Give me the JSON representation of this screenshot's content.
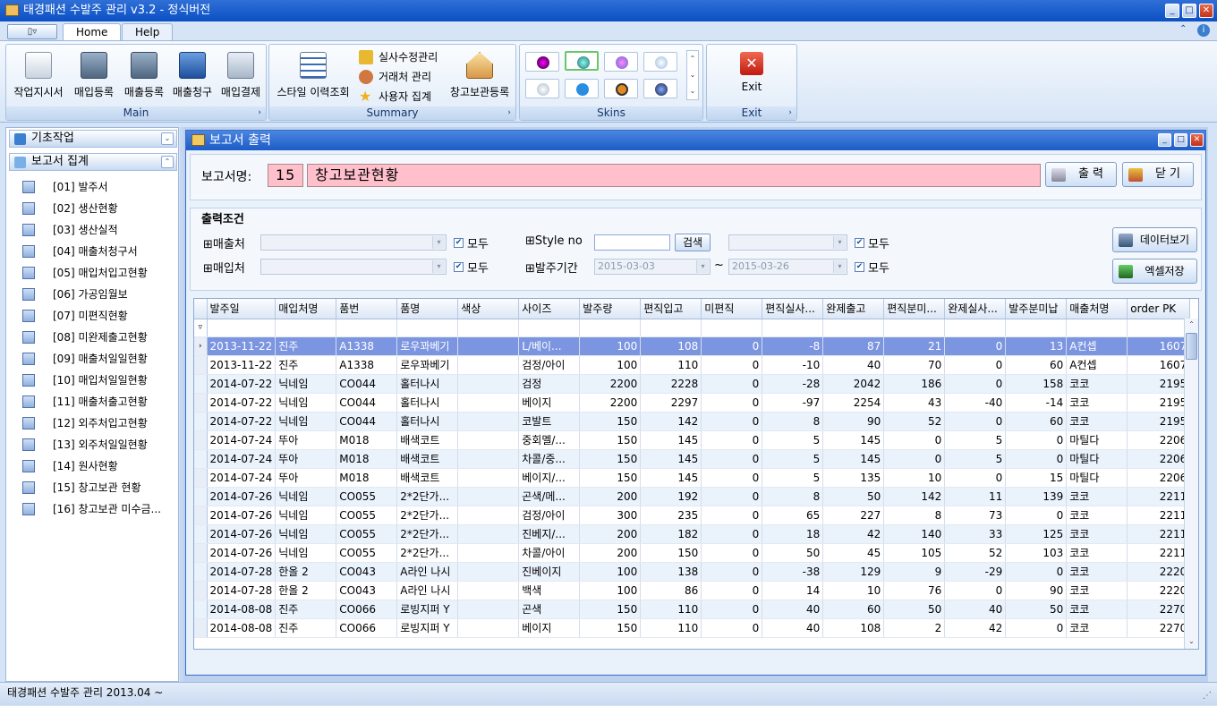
{
  "app": {
    "title": "태경패션 수발주 관리 v3.2 - 정식버전"
  },
  "ribbon": {
    "tabs": [
      "Home",
      "Help"
    ],
    "groups": {
      "main": {
        "caption": "Main",
        "buttons": [
          "작업지시서",
          "매입등록",
          "매출등록",
          "매출청구",
          "매입결제"
        ]
      },
      "summary": {
        "caption": "Summary",
        "big_button": "스타일 이력조회",
        "small_buttons": [
          "실사수정관리",
          "거래처 관리",
          "사용자 집계"
        ],
        "big_button2": "창고보관등록"
      },
      "skins": {
        "caption": "Skins"
      },
      "exit": {
        "caption": "Exit",
        "button": "Exit"
      }
    }
  },
  "nav": {
    "sections": [
      "기초작업",
      "보고서 집계"
    ],
    "items": [
      "[01] 발주서",
      "[02] 생산현황",
      "[03] 생산실적",
      "[04] 매출처청구서",
      "[05] 매입처입고현황",
      "[06] 가공임월보",
      "[07] 미편직현황",
      "[08] 미완제출고현황",
      "[09] 매출처일일현황",
      "[10] 매입처일일현황",
      "[11] 매출처출고현황",
      "[12] 외주처입고현황",
      "[13] 외주처일일현황",
      "[14] 원사현황",
      "[15] 창고보관 현황",
      "[16] 창고보관 미수금..."
    ]
  },
  "report": {
    "window_title": "보고서 출력",
    "name_label": "보고서명:",
    "number": "15",
    "name": "창고보관현황",
    "print_button": "출 력",
    "close_button": "닫 기",
    "conditions_title": "출력조건",
    "filters": {
      "sales_label": "⊞매출처",
      "purchase_label": "⊞매입처",
      "all_label": "모두",
      "style_label": "⊞Style no",
      "search_button": "검색",
      "period_label": "⊞발주기간",
      "date_from": "2015-03-03",
      "date_to": "2015-03-26",
      "tilde": "~"
    },
    "view_data_button": "데이터보기",
    "excel_button": "엑셀저장"
  },
  "grid": {
    "columns": [
      "발주일",
      "매입처명",
      "품번",
      "품명",
      "색상",
      "사이즈",
      "발주량",
      "편직입고",
      "미편직",
      "편직실사...",
      "완제출고",
      "편직분미...",
      "완제실사...",
      "발주분미납",
      "매출처명",
      "order PK"
    ],
    "rows": [
      [
        "2013-11-22",
        "진주",
        "A1338",
        "로우꽈베기",
        "",
        "L/베이...",
        "100",
        "108",
        "0",
        "-8",
        "87",
        "21",
        "0",
        "13",
        "A컨셉",
        "1607"
      ],
      [
        "2013-11-22",
        "진주",
        "A1338",
        "로우꽈베기",
        "",
        "검정/아이",
        "100",
        "110",
        "0",
        "-10",
        "40",
        "70",
        "0",
        "60",
        "A컨셉",
        "1607"
      ],
      [
        "2014-07-22",
        "닉네임",
        "CO044",
        "홀터나시",
        "",
        "검정",
        "2200",
        "2228",
        "0",
        "-28",
        "2042",
        "186",
        "0",
        "158",
        "코코",
        "2195"
      ],
      [
        "2014-07-22",
        "닉네임",
        "CO044",
        "홀터나시",
        "",
        "베이지",
        "2200",
        "2297",
        "0",
        "-97",
        "2254",
        "43",
        "-40",
        "-14",
        "코코",
        "2195"
      ],
      [
        "2014-07-22",
        "닉네임",
        "CO044",
        "홀터나시",
        "",
        "코발트",
        "150",
        "142",
        "0",
        "8",
        "90",
        "52",
        "0",
        "60",
        "코코",
        "2195"
      ],
      [
        "2014-07-24",
        "뚜아",
        "M018",
        "배색코트",
        "",
        "중회멜/...",
        "150",
        "145",
        "0",
        "5",
        "145",
        "0",
        "5",
        "0",
        "마틸다",
        "2206"
      ],
      [
        "2014-07-24",
        "뚜아",
        "M018",
        "배색코트",
        "",
        "차콜/중...",
        "150",
        "145",
        "0",
        "5",
        "145",
        "0",
        "5",
        "0",
        "마틸다",
        "2206"
      ],
      [
        "2014-07-24",
        "뚜아",
        "M018",
        "배색코트",
        "",
        "베이지/...",
        "150",
        "145",
        "0",
        "5",
        "135",
        "10",
        "0",
        "15",
        "마틸다",
        "2206"
      ],
      [
        "2014-07-26",
        "닉네임",
        "CO055",
        "2*2단가...",
        "",
        "곤색/메...",
        "200",
        "192",
        "0",
        "8",
        "50",
        "142",
        "11",
        "139",
        "코코",
        "2211"
      ],
      [
        "2014-07-26",
        "닉네임",
        "CO055",
        "2*2단가...",
        "",
        "검정/아이",
        "300",
        "235",
        "0",
        "65",
        "227",
        "8",
        "73",
        "0",
        "코코",
        "2211"
      ],
      [
        "2014-07-26",
        "닉네임",
        "CO055",
        "2*2단가...",
        "",
        "진베지/...",
        "200",
        "182",
        "0",
        "18",
        "42",
        "140",
        "33",
        "125",
        "코코",
        "2211"
      ],
      [
        "2014-07-26",
        "닉네임",
        "CO055",
        "2*2단가...",
        "",
        "차콜/아이",
        "200",
        "150",
        "0",
        "50",
        "45",
        "105",
        "52",
        "103",
        "코코",
        "2211"
      ],
      [
        "2014-07-28",
        "한올 2",
        "CO043",
        "A라인 나시",
        "",
        "진베이지",
        "100",
        "138",
        "0",
        "-38",
        "129",
        "9",
        "-29",
        "0",
        "코코",
        "2220"
      ],
      [
        "2014-07-28",
        "한올 2",
        "CO043",
        "A라인 나시",
        "",
        "백색",
        "100",
        "86",
        "0",
        "14",
        "10",
        "76",
        "0",
        "90",
        "코코",
        "2220"
      ],
      [
        "2014-08-08",
        "진주",
        "CO066",
        "로빙지퍼 Y",
        "",
        "곤색",
        "150",
        "110",
        "0",
        "40",
        "60",
        "50",
        "40",
        "50",
        "코코",
        "2270"
      ],
      [
        "2014-08-08",
        "진주",
        "CO066",
        "로빙지퍼 Y",
        "",
        "베이지",
        "150",
        "110",
        "0",
        "40",
        "108",
        "2",
        "42",
        "0",
        "코코",
        "2270"
      ]
    ]
  },
  "status": {
    "text": "태경패션 수발주 관리  2013.04 ~"
  },
  "colors": {
    "titlebar": "#0b4fc4",
    "selected_row": "#7c95e0",
    "pink": "#ffc0cb"
  }
}
